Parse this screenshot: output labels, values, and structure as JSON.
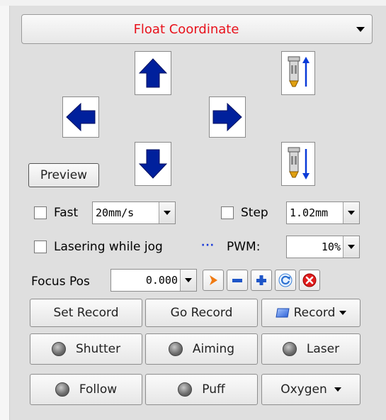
{
  "mode_dropdown": {
    "label": "Float Coordinate",
    "color": "#e8111b"
  },
  "jog": {
    "up_icon": "arrow-up-icon",
    "down_icon": "arrow-down-icon",
    "left_icon": "arrow-left-icon",
    "right_icon": "arrow-right-icon",
    "z_up_icon": "laser-head-up-icon",
    "z_down_icon": "laser-head-down-icon",
    "arrow_color": "#00209c"
  },
  "preview_button": "Preview",
  "fast": {
    "label": "Fast",
    "value": "20mm/s"
  },
  "step": {
    "label": "Step",
    "value": "1.02mm"
  },
  "lasering": {
    "label": "Lasering while jog",
    "more": "···"
  },
  "pwm": {
    "label": "PWM:",
    "value": "10%"
  },
  "focus": {
    "label": "Focus Pos",
    "value": "0.000"
  },
  "focus_tools": [
    "play-icon",
    "minus-icon",
    "plus-icon",
    "refresh-icon",
    "close-icon"
  ],
  "record_row": {
    "set": "Set Record",
    "go": "Go Record",
    "record": "Record"
  },
  "status_row1": {
    "shutter": "Shutter",
    "aiming": "Aiming",
    "laser": "Laser"
  },
  "status_row2": {
    "follow": "Follow",
    "puff": "Puff",
    "oxygen": "Oxygen"
  }
}
